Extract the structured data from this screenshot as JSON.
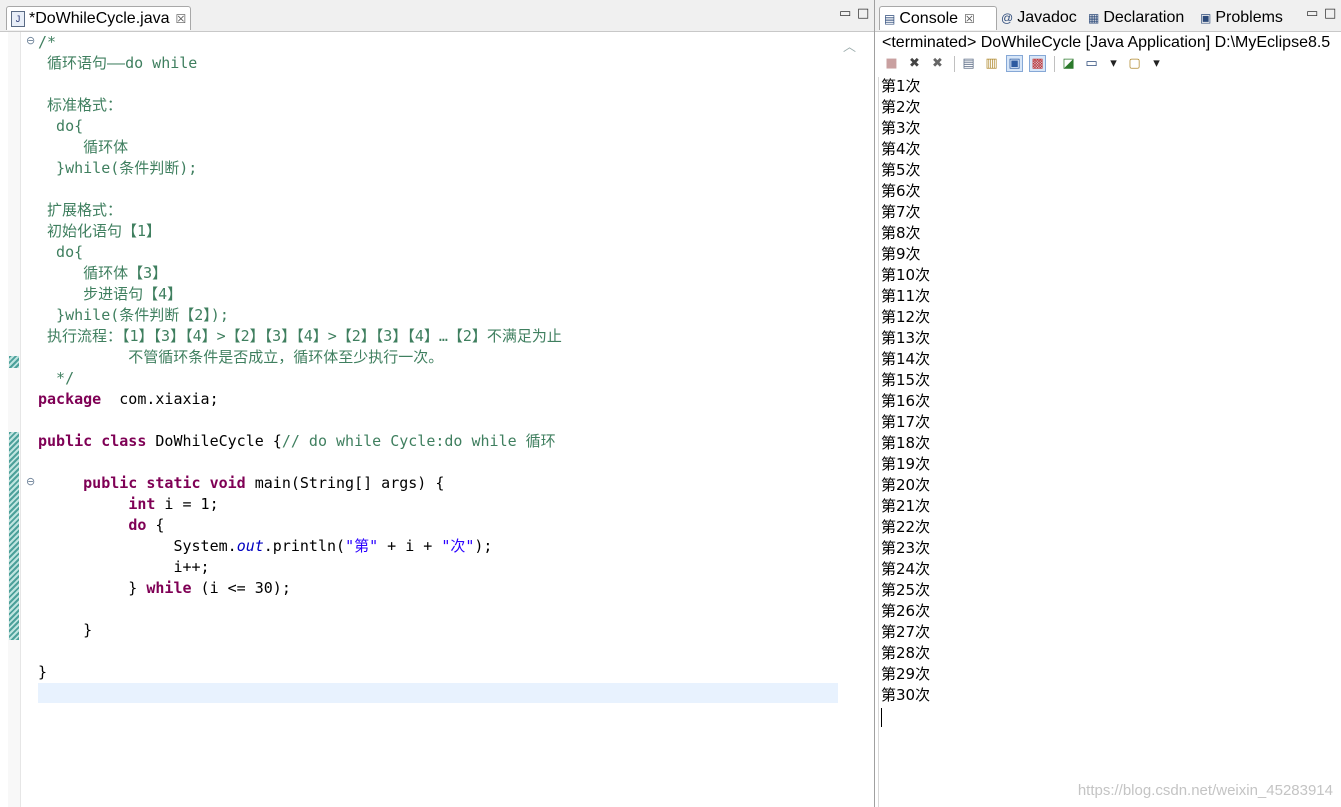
{
  "editor": {
    "tab_title": "*DoWhileCycle.java",
    "tab_icon_glyph": "J",
    "close_glyph": "☒",
    "minimize_glyph": "▭",
    "maximize_glyph": "□",
    "code_lines": [
      [
        [
          "cm",
          "/*"
        ]
      ],
      [
        [
          "cm",
          " 循环语句——do while"
        ]
      ],
      [],
      [
        [
          "cm",
          " 标准格式："
        ]
      ],
      [
        [
          "cm",
          "  do{"
        ]
      ],
      [
        [
          "cm",
          "     循环体"
        ]
      ],
      [
        [
          "cm",
          "  }while(条件判断);"
        ]
      ],
      [],
      [
        [
          "cm",
          " 扩展格式："
        ]
      ],
      [
        [
          "cm",
          " 初始化语句【1】"
        ]
      ],
      [
        [
          "cm",
          "  do{"
        ]
      ],
      [
        [
          "cm",
          "     循环体【3】"
        ]
      ],
      [
        [
          "cm",
          "     步进语句【4】"
        ]
      ],
      [
        [
          "cm",
          "  }while(条件判断【2】);"
        ]
      ],
      [
        [
          "cm",
          " 执行流程：【1】【3】【4】>【2】【3】【4】>【2】【3】【4】…【2】不满足为止"
        ]
      ],
      [
        [
          "cm",
          "          不管循环条件是否成立，循环体至少执行一次。"
        ]
      ],
      [
        [
          "cm",
          "  */"
        ]
      ],
      [
        [
          "kw",
          "package"
        ],
        [
          "",
          "  com.xiaxia;"
        ]
      ],
      [],
      [
        [
          "kw",
          "public"
        ],
        [
          "",
          " "
        ],
        [
          "kw",
          "class"
        ],
        [
          "",
          " DoWhileCycle {"
        ],
        [
          "cm",
          "// do while Cycle:do while 循环"
        ]
      ],
      [],
      [
        [
          "",
          "     "
        ],
        [
          "kw",
          "public"
        ],
        [
          "",
          " "
        ],
        [
          "kw",
          "static"
        ],
        [
          "",
          " "
        ],
        [
          "kw",
          "void"
        ],
        [
          "",
          " main(String[] args) {"
        ]
      ],
      [
        [
          "",
          "          "
        ],
        [
          "kw",
          "int"
        ],
        [
          "",
          " i = 1;"
        ]
      ],
      [
        [
          "",
          "          "
        ],
        [
          "kw",
          "do"
        ],
        [
          "",
          " {"
        ]
      ],
      [
        [
          "",
          "               System."
        ],
        [
          "fld",
          "out"
        ],
        [
          "",
          ".println("
        ],
        [
          "str",
          "\"第\""
        ],
        [
          "",
          " + i + "
        ],
        [
          "str",
          "\"次\""
        ],
        [
          "",
          ");"
        ]
      ],
      [
        [
          "",
          "               i++;"
        ]
      ],
      [
        [
          "",
          "          } "
        ],
        [
          "kw",
          "while"
        ],
        [
          "",
          " (i <= 30);"
        ]
      ],
      [],
      [
        [
          "",
          "     }"
        ]
      ],
      [],
      [
        [
          "",
          "}"
        ]
      ]
    ]
  },
  "console": {
    "tabs": [
      {
        "label": "Console",
        "icon": "console-icon",
        "glyph": "▤",
        "active": true,
        "close": "☒"
      },
      {
        "label": "Javadoc",
        "icon": "javadoc-icon",
        "glyph": "@",
        "active": false
      },
      {
        "label": "Declaration",
        "icon": "declaration-icon",
        "glyph": "▦",
        "active": false
      },
      {
        "label": "Problems",
        "icon": "problems-icon",
        "glyph": "▣",
        "active": false
      }
    ],
    "minimize_glyph": "▭",
    "maximize_glyph": "□",
    "status": "<terminated> DoWhileCycle [Java Application] D:\\MyEclipse8.5",
    "toolbar": [
      {
        "name": "terminate-icon",
        "glyph": "■"
      },
      {
        "name": "remove-launch-icon",
        "glyph": "✖"
      },
      {
        "name": "remove-all-terminated-icon",
        "glyph": "✖"
      },
      {
        "name": "clear-console-icon",
        "glyph": "▤"
      },
      {
        "name": "scroll-lock-icon",
        "glyph": "▥"
      },
      {
        "name": "word-wrap-icon",
        "glyph": "▣",
        "on": true
      },
      {
        "name": "show-console-output-icon",
        "glyph": "▩",
        "on": true
      },
      {
        "name": "pin-console-icon",
        "glyph": "◪"
      },
      {
        "name": "display-selected-console-icon",
        "glyph": "▭"
      },
      {
        "name": "display-dropdown-icon",
        "glyph": "▾"
      },
      {
        "name": "open-console-icon",
        "glyph": "▢"
      },
      {
        "name": "open-console-dropdown-icon",
        "glyph": "▾"
      }
    ],
    "output_lines": [
      "第1次",
      "第2次",
      "第3次",
      "第4次",
      "第5次",
      "第6次",
      "第7次",
      "第8次",
      "第9次",
      "第10次",
      "第11次",
      "第12次",
      "第13次",
      "第14次",
      "第15次",
      "第16次",
      "第17次",
      "第18次",
      "第19次",
      "第20次",
      "第21次",
      "第22次",
      "第23次",
      "第24次",
      "第25次",
      "第26次",
      "第27次",
      "第28次",
      "第29次",
      "第30次"
    ]
  },
  "watermark": "https://blog.csdn.net/weixin_45283914"
}
